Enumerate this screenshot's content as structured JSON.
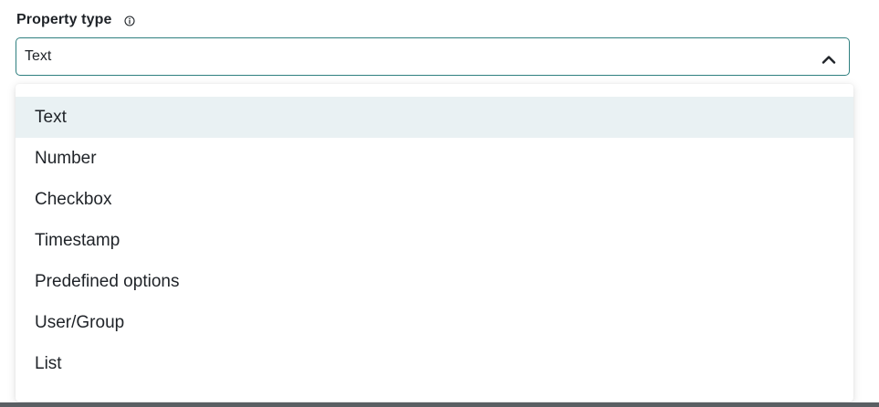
{
  "field": {
    "label": "Property type",
    "info_icon": "info-circle-icon",
    "selected_value": "Text",
    "toggle_icon": "chevron-up-icon",
    "accent_color": "#2f7f7f"
  },
  "dropdown": {
    "highlight_color": "#e9f1f3",
    "options": [
      {
        "label": "Text",
        "selected": true
      },
      {
        "label": "Number",
        "selected": false
      },
      {
        "label": "Checkbox",
        "selected": false
      },
      {
        "label": "Timestamp",
        "selected": false
      },
      {
        "label": "Predefined options",
        "selected": false
      },
      {
        "label": "User/Group",
        "selected": false
      },
      {
        "label": "List",
        "selected": false
      }
    ]
  }
}
